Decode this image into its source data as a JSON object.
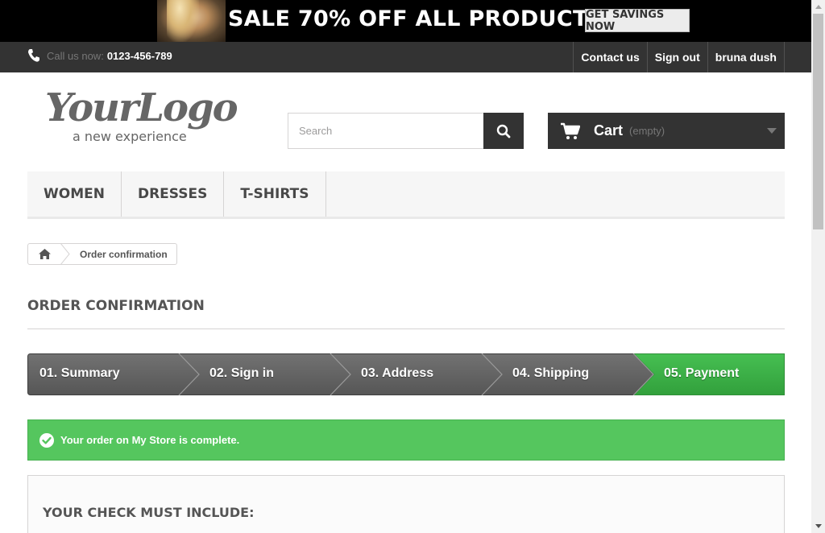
{
  "banner": {
    "text": "SALE 70% OFF ALL PRODUCTS",
    "button": "GET SAVINGS NOW"
  },
  "topbar": {
    "call_label": "Call us now:",
    "phone": "0123-456-789",
    "links": [
      "Contact us",
      "Sign out",
      "bruna dush"
    ]
  },
  "logo": {
    "main": "YourLogo",
    "tagline": "a new experience"
  },
  "search": {
    "placeholder": "Search",
    "value": ""
  },
  "cart": {
    "label": "Cart",
    "status": "(empty)"
  },
  "menu": [
    "WOMEN",
    "DRESSES",
    "T-SHIRTS"
  ],
  "breadcrumb": {
    "current": "Order confirmation"
  },
  "page": {
    "title": "ORDER CONFIRMATION"
  },
  "steps": [
    "01. Summary",
    "02. Sign in",
    "03. Address",
    "04. Shipping",
    "05. Payment"
  ],
  "alert": {
    "message": "Your order on My Store is complete."
  },
  "box": {
    "title": "YOUR CHECK MUST INCLUDE:"
  },
  "colors": {
    "dark": "#333333",
    "success": "#55c65e",
    "step_gray": "#5f5f5f",
    "step_active": "#3aa845"
  }
}
